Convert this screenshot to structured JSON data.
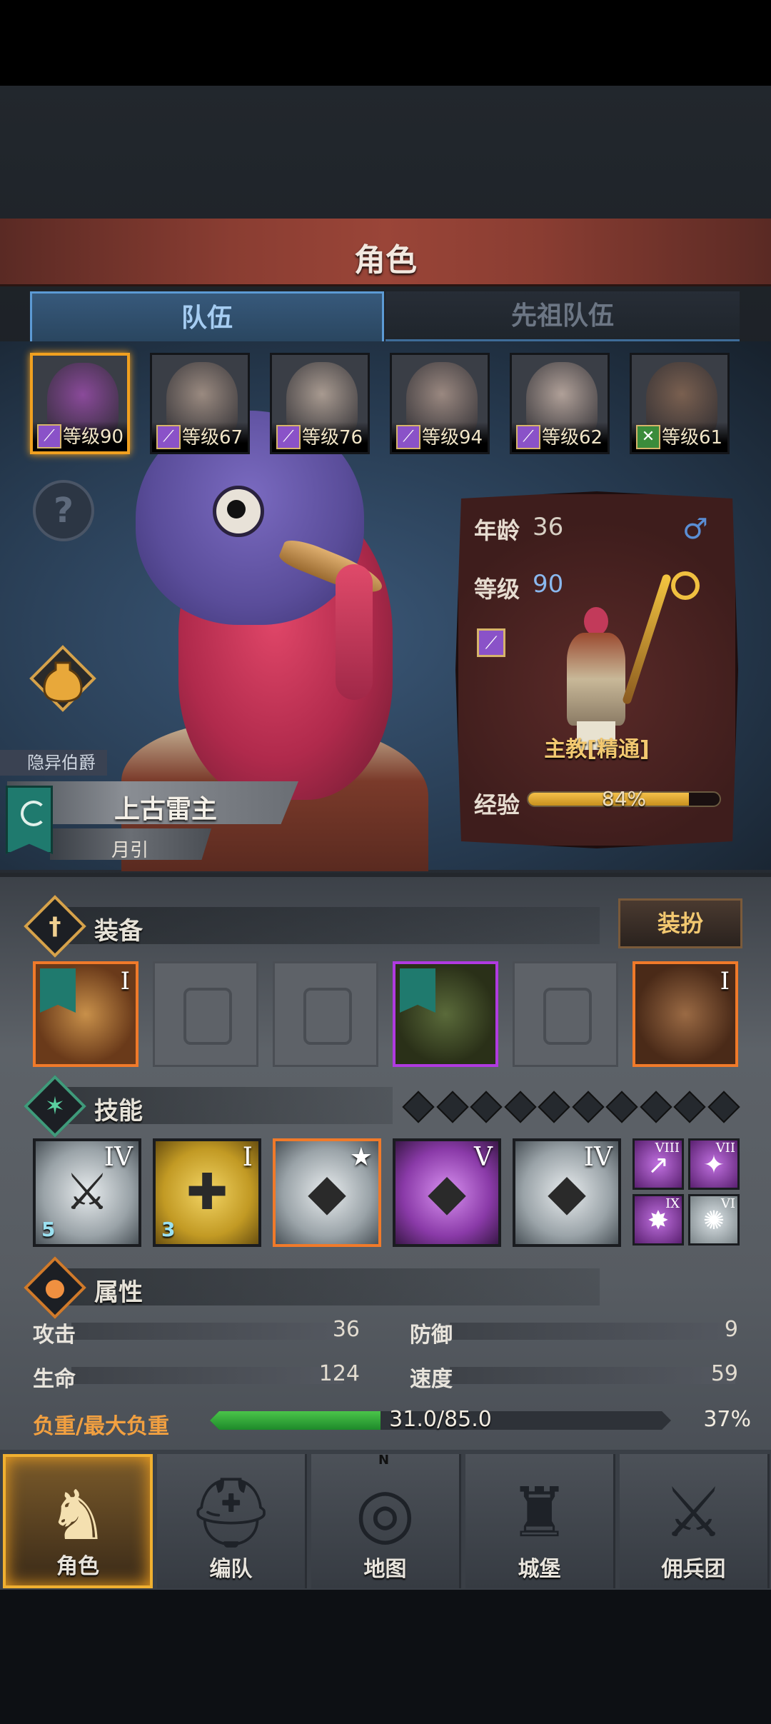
{
  "header": {
    "title": "角色"
  },
  "tabs": [
    {
      "label": "队伍",
      "active": true
    },
    {
      "label": "先祖队伍",
      "active": false
    }
  ],
  "roster": [
    {
      "level_text": "等级90",
      "class_icon": "staff-icon",
      "selected": true,
      "face": "#8a4a9a"
    },
    {
      "level_text": "等级67",
      "class_icon": "staff-icon",
      "selected": false,
      "face": "#9a8a80"
    },
    {
      "level_text": "等级76",
      "class_icon": "staff-icon",
      "selected": false,
      "face": "#a89a90"
    },
    {
      "level_text": "等级94",
      "class_icon": "staff-icon",
      "selected": false,
      "face": "#9a8880"
    },
    {
      "level_text": "等级62",
      "class_icon": "staff-icon",
      "selected": false,
      "face": "#b0a098"
    },
    {
      "level_text": "等级61",
      "class_icon": "crossed-swords-icon",
      "selected": false,
      "face": "#7a6050"
    }
  ],
  "hero": {
    "title_small": "隐异伯爵",
    "name": "上古雷主",
    "subtitle": "月引",
    "age_label": "年龄",
    "age": "36",
    "gender_icon": "male-icon",
    "level_label": "等级",
    "level": "90",
    "class_name": "主教[精通]",
    "exp_label": "经验",
    "exp_percent": 84,
    "exp_text": "84%"
  },
  "equipment": {
    "title": "装备",
    "dress_button": "装扮",
    "slots": [
      {
        "roman": "I",
        "state": "orange",
        "has_banner": true
      },
      {
        "roman": "",
        "state": "empty",
        "ghost": "shield-icon"
      },
      {
        "roman": "",
        "state": "empty",
        "ghost": "helmet-icon"
      },
      {
        "roman": "",
        "state": "purple",
        "has_banner": true
      },
      {
        "roman": "",
        "state": "empty",
        "ghost": "boots-icon"
      },
      {
        "roman": "I",
        "state": "orange",
        "has_banner": false
      }
    ]
  },
  "skills": {
    "title": "技能",
    "pips": 10,
    "main": [
      {
        "roman": "IV",
        "color": "gray",
        "badge": "5",
        "glyph": "⚔"
      },
      {
        "roman": "I",
        "color": "gold",
        "badge": "3",
        "glyph": "✚"
      },
      {
        "roman": "★",
        "color": "gray",
        "badge": "",
        "glyph": "◆",
        "orange": true
      },
      {
        "roman": "V",
        "color": "purple",
        "badge": "",
        "glyph": "◆"
      },
      {
        "roman": "IV",
        "color": "gray",
        "badge": "",
        "glyph": "◆"
      }
    ],
    "mini": [
      {
        "roman": "VIII",
        "glyph": "↗"
      },
      {
        "roman": "VII",
        "glyph": "✦"
      },
      {
        "roman": "IX",
        "glyph": "✸"
      },
      {
        "roman": "VI",
        "glyph": "✺"
      }
    ]
  },
  "attributes": {
    "title": "属性",
    "attack_label": "攻击",
    "attack": "36",
    "defense_label": "防御",
    "defense": "9",
    "hp_label": "生命",
    "hp": "124",
    "speed_label": "速度",
    "speed": "59",
    "load_label": "负重/最大负重",
    "load_text": "31.0/85.0",
    "load_fraction": 0.37,
    "load_percent": "37%"
  },
  "nav": [
    {
      "label": "角色",
      "icon": "knight-icon",
      "active": true
    },
    {
      "label": "编队",
      "icon": "helmet-icon",
      "active": false
    },
    {
      "label": "地图",
      "icon": "compass-icon",
      "active": false
    },
    {
      "label": "城堡",
      "icon": "castle-icon",
      "active": false
    },
    {
      "label": "佣兵团",
      "icon": "mercenary-icon",
      "active": false
    }
  ],
  "compass_letter": "N"
}
